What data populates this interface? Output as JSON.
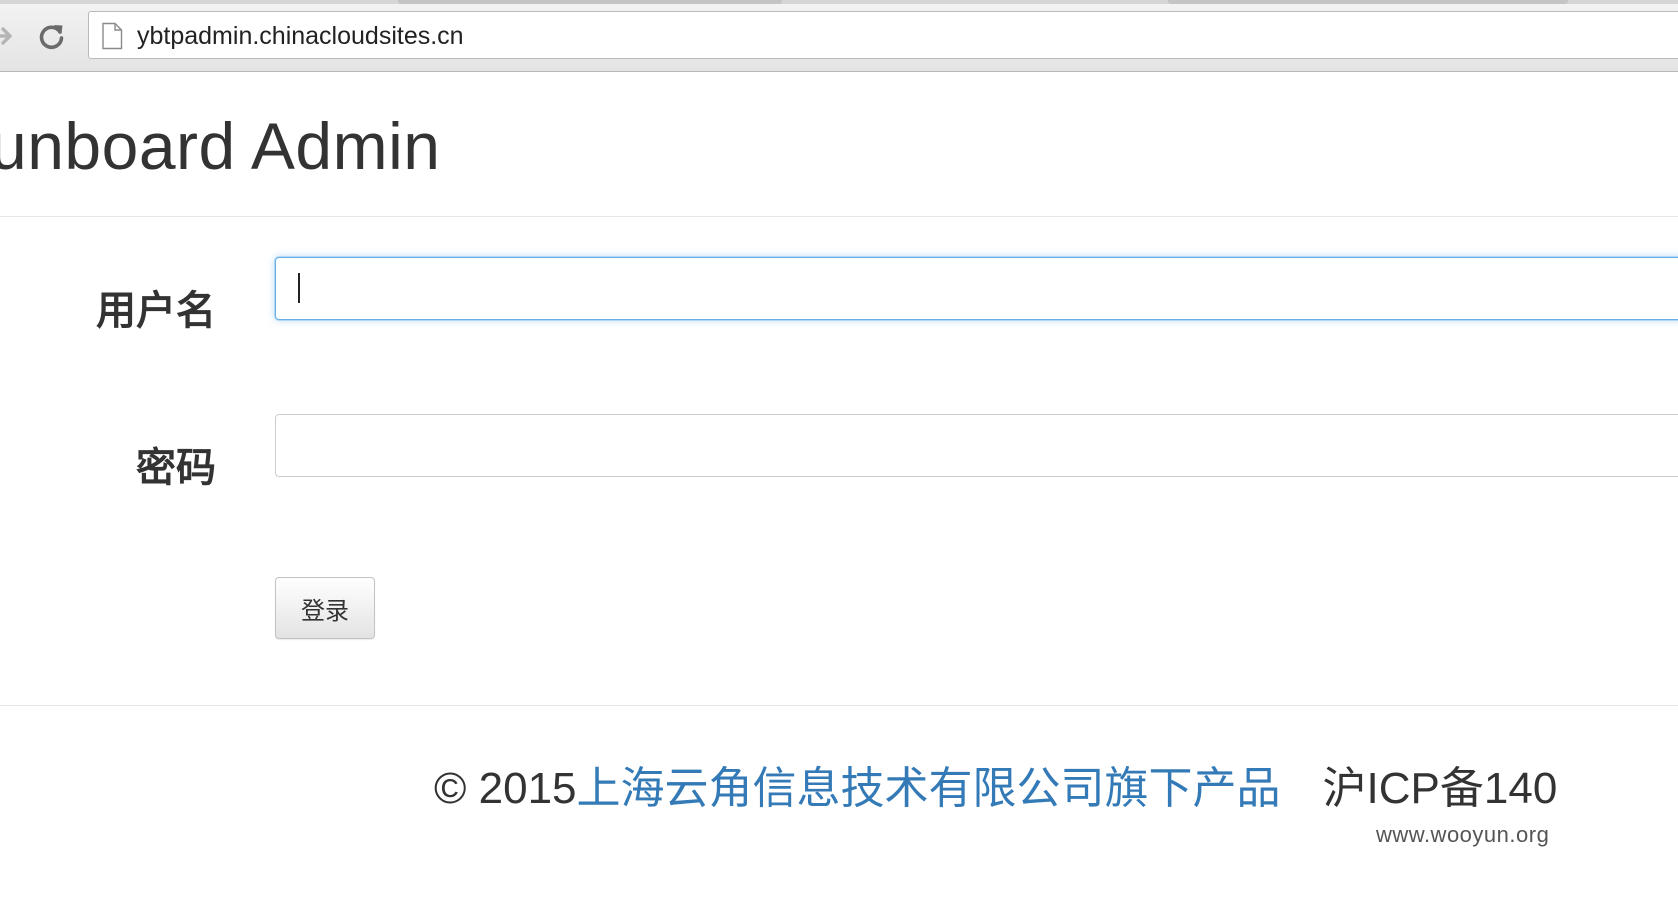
{
  "browser": {
    "url": "ybtpadmin.chinacloudsites.cn"
  },
  "page": {
    "title": "unboard Admin"
  },
  "form": {
    "username_label": "用户名",
    "username_value": "",
    "password_label": "密码",
    "password_value": "",
    "submit_label": "登录"
  },
  "footer": {
    "copyright": "© 2015",
    "company_link": "上海云角信息技术有限公司旗下产品",
    "icp": "沪ICP备140"
  },
  "watermark": "www.wooyun.org",
  "colors": {
    "link": "#337ab7",
    "focus_border": "#66afe9",
    "text": "#333333"
  },
  "icons": [
    "forward-icon",
    "reload-icon",
    "page-icon"
  ]
}
